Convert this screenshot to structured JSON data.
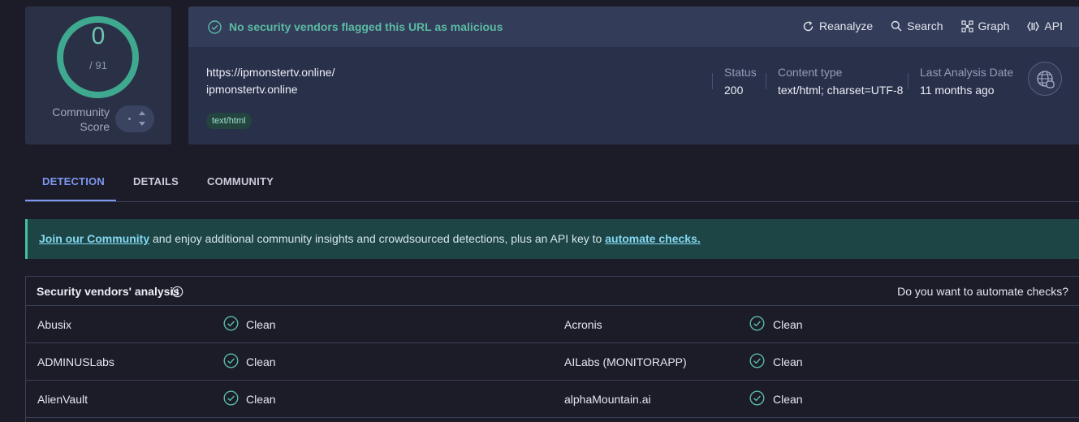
{
  "score": {
    "value": "0",
    "total": "/ 91",
    "community_label_line1": "Community",
    "community_label_line2": "Score"
  },
  "header": {
    "flag_text": "No security vendors flagged this URL as malicious",
    "actions": [
      {
        "label": "Reanalyze",
        "icon": "refresh-icon"
      },
      {
        "label": "Search",
        "icon": "search-icon"
      },
      {
        "label": "Graph",
        "icon": "graph-icon"
      },
      {
        "label": "API",
        "icon": "api-icon"
      }
    ]
  },
  "info": {
    "url": "https://ipmonstertv.online/",
    "domain": "ipmonstertv.online",
    "tag": "text/html",
    "status_label": "Status",
    "status_value": "200",
    "content_type_label": "Content type",
    "content_type_value": "text/html; charset=UTF-8",
    "last_analysis_label": "Last Analysis Date",
    "last_analysis_value": "11 months ago"
  },
  "tabs": [
    {
      "label": "DETECTION",
      "active": true
    },
    {
      "label": "DETAILS",
      "active": false
    },
    {
      "label": "COMMUNITY",
      "active": false
    }
  ],
  "banner": {
    "link1": "Join our Community",
    "middle": " and enjoy additional community insights and crowdsourced detections, plus an API key to ",
    "link2": "automate checks."
  },
  "vendors": {
    "title": "Security vendors' analysis",
    "automate_prompt": "Do you want to automate checks?",
    "rows": [
      {
        "left_name": "Abusix",
        "left_result": "Clean",
        "right_name": "Acronis",
        "right_result": "Clean"
      },
      {
        "left_name": "ADMINUSLabs",
        "left_result": "Clean",
        "right_name": "AILabs (MONITORAPP)",
        "right_result": "Clean"
      },
      {
        "left_name": "AlienVault",
        "left_result": "Clean",
        "right_name": "alphaMountain.ai",
        "right_result": "Clean"
      }
    ]
  },
  "colors": {
    "clean": "#5bbba4",
    "accent": "#7e97f0"
  }
}
